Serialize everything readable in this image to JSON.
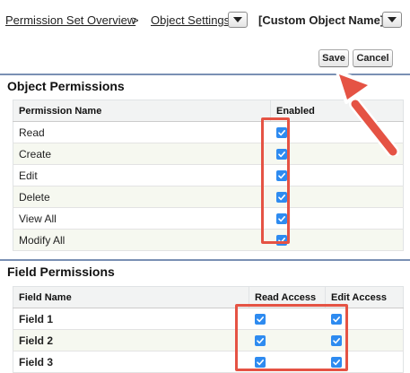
{
  "breadcrumb": {
    "overview_label": "Permission Set Overview",
    "separator": ">",
    "object_settings_label": "Object Settings",
    "current_label": "[Custom Object Name]"
  },
  "toolbar": {
    "save_label": "Save",
    "cancel_label": "Cancel"
  },
  "object_permissions": {
    "title": "Object Permissions",
    "columns": [
      "Permission Name",
      "Enabled"
    ],
    "rows": [
      {
        "name": "Read",
        "enabled": true
      },
      {
        "name": "Create",
        "enabled": true
      },
      {
        "name": "Edit",
        "enabled": true
      },
      {
        "name": "Delete",
        "enabled": true
      },
      {
        "name": "View All",
        "enabled": true
      },
      {
        "name": "Modify All",
        "enabled": true
      }
    ]
  },
  "field_permissions": {
    "title": "Field Permissions",
    "columns": [
      "Field Name",
      "Read Access",
      "Edit Access"
    ],
    "rows": [
      {
        "name": "Field 1",
        "read": true,
        "edit": true
      },
      {
        "name": "Field 2",
        "read": true,
        "edit": true
      },
      {
        "name": "Field 3",
        "read": true,
        "edit": true
      }
    ]
  },
  "colors": {
    "checkbox": "#2e8bf0",
    "highlight": "#e55344",
    "section_bar": "#7a90b4"
  },
  "icons": [
    "dropdown-arrow-icon",
    "checkmark-icon",
    "annotation-arrow-icon"
  ]
}
